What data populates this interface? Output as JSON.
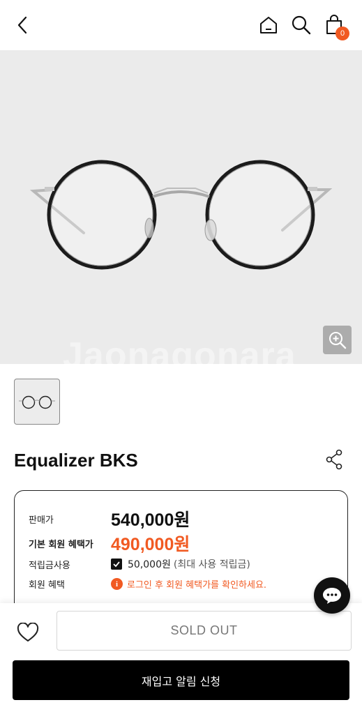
{
  "header": {
    "back_icon": "chevron-left-icon",
    "home_icon": "home-icon",
    "search_icon": "search-icon",
    "cart_icon": "shopping-bag-icon",
    "cart_count": "0",
    "accent_color": "#f15a22"
  },
  "product": {
    "image_watermark": "Jaonagonara",
    "zoom_icon": "zoom-in-icon",
    "name": "Equalizer BKS",
    "share_icon": "share-icon"
  },
  "prices": {
    "sale_label": "판매가",
    "sale_value": "540,000원",
    "member_label": "기본 회원 혜택가",
    "member_value": "490,000원",
    "points_label": "적립금사용",
    "points_value": "50,000원",
    "points_note": "(최대 사용 적립금)",
    "benefit_label": "회원 혜택",
    "benefit_message": "로그인 후 회원 혜택가를 확인하세요."
  },
  "actions": {
    "wishlist_icon": "heart-icon",
    "soldout_label": "SOLD OUT",
    "restock_label": "재입고 알림 신청",
    "chat_icon": "chat-bubble-icon"
  }
}
